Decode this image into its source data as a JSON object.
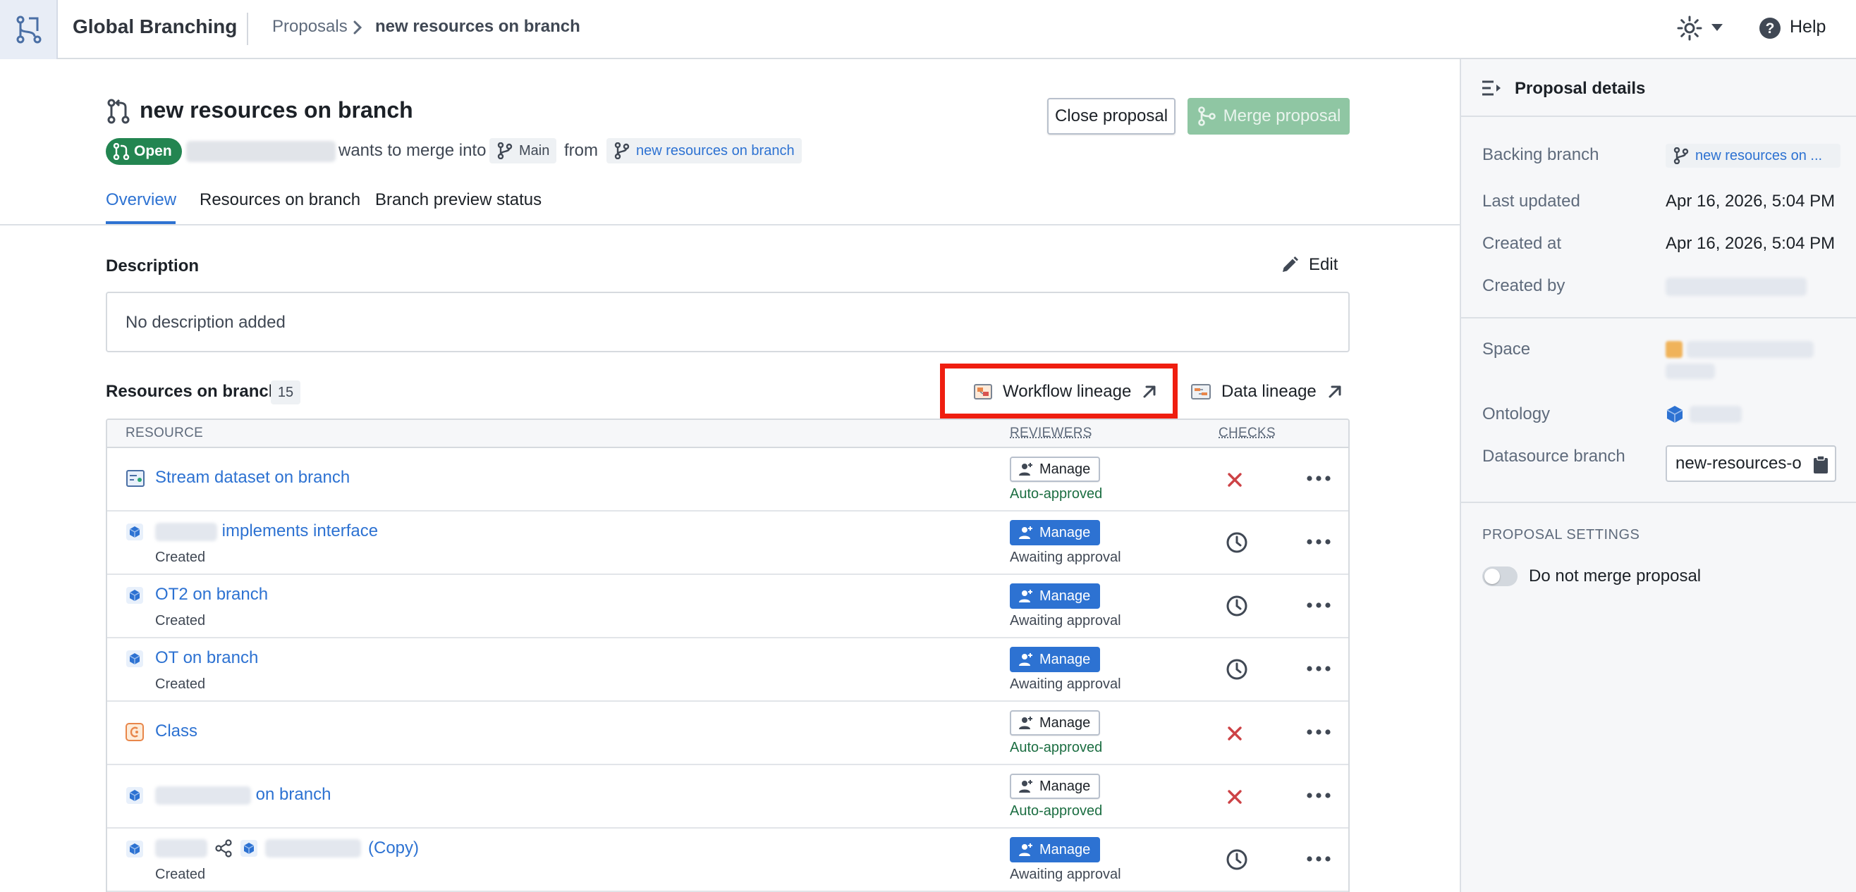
{
  "app": {
    "title": "Global Branching"
  },
  "breadcrumb": {
    "parent": "Proposals",
    "current": "new resources on branch"
  },
  "topbar": {
    "help_label": "Help"
  },
  "proposal": {
    "title": "new resources on branch",
    "status": "Open",
    "wants_text": "wants to merge into",
    "target_branch": "Main",
    "from_text": "from",
    "source_branch": "new resources on branch",
    "close_label": "Close proposal",
    "merge_label": "Merge proposal"
  },
  "tabs": [
    {
      "label": "Overview"
    },
    {
      "label": "Resources on branch"
    },
    {
      "label": "Branch preview status"
    }
  ],
  "description": {
    "label": "Description",
    "edit_label": "Edit",
    "text": "No description added"
  },
  "resources": {
    "label": "Resources on branch",
    "count": "15",
    "workflow_lineage": "Workflow lineage",
    "data_lineage": "Data lineage",
    "columns": {
      "resource": "RESOURCE",
      "reviewers": "REVIEWERS",
      "checks": "CHECKS"
    },
    "manage_label": "Manage",
    "rows": [
      {
        "name": "Stream dataset on branch",
        "sub": "",
        "status": "Auto-approved",
        "check": "failed"
      },
      {
        "name": "implements interface",
        "sub": "Created",
        "status": "Awaiting approval",
        "check": "pending"
      },
      {
        "name": "OT2 on branch",
        "sub": "Created",
        "status": "Awaiting approval",
        "check": "pending"
      },
      {
        "name": "OT on branch",
        "sub": "Created",
        "status": "Awaiting approval",
        "check": "pending"
      },
      {
        "name": "Class",
        "sub": "",
        "status": "Auto-approved",
        "check": "failed"
      },
      {
        "name": "on branch",
        "sub": "",
        "status": "Auto-approved",
        "check": "failed"
      },
      {
        "name": "(Copy)",
        "sub": "Created",
        "status": "Awaiting approval",
        "check": "pending"
      }
    ]
  },
  "details": {
    "title": "Proposal details",
    "backing_branch_label": "Backing branch",
    "backing_branch": "new resources on ...",
    "last_updated_label": "Last updated",
    "last_updated": "Apr 16, 2026, 5:04 PM",
    "created_at_label": "Created at",
    "created_at": "Apr 16, 2026, 5:04 PM",
    "created_by_label": "Created by",
    "space_label": "Space",
    "ontology_label": "Ontology",
    "datasource_branch_label": "Datasource branch",
    "datasource_branch": "new-resources-on-branch",
    "settings_label": "PROPOSAL SETTINGS",
    "do_not_merge_label": "Do not merge proposal"
  },
  "colors": {
    "accent": "#2d72d2",
    "open_green": "#238551",
    "approved_green": "#1c6e42",
    "danger_red": "#cd4246",
    "highlight_red": "#ef1e10"
  }
}
